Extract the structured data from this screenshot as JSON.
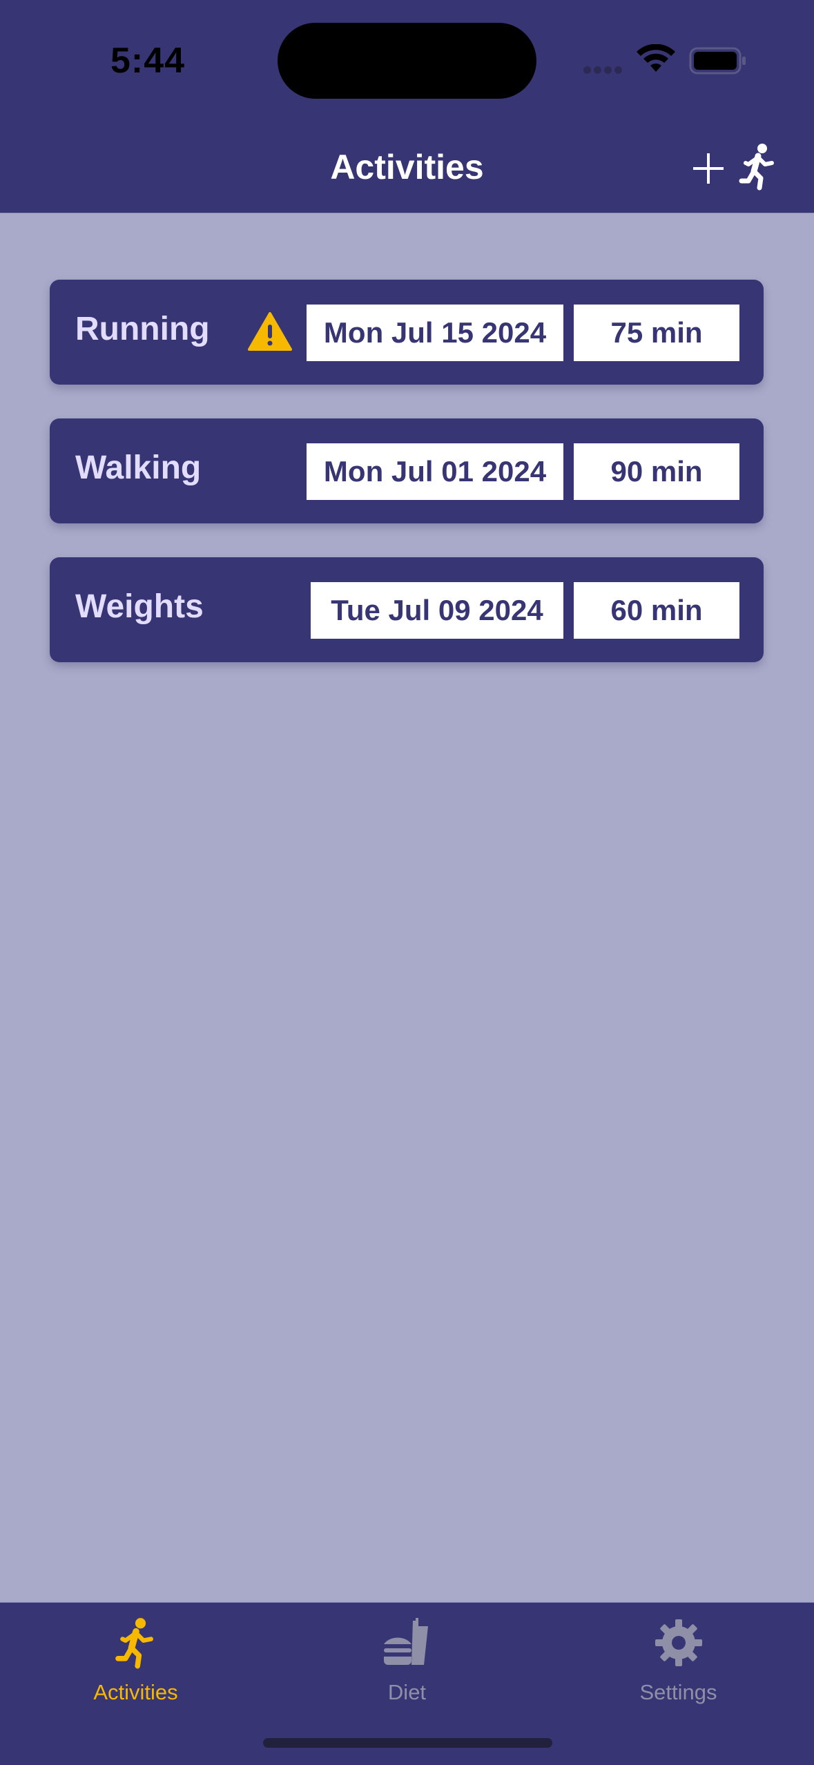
{
  "status_bar": {
    "time": "5:44",
    "icons": [
      "wifi-icon",
      "battery-icon"
    ]
  },
  "nav": {
    "title": "Activities",
    "actions": [
      {
        "icon": "plus-icon"
      },
      {
        "icon": "running-figure-icon"
      }
    ]
  },
  "activities": [
    {
      "name": "Running",
      "warning": true,
      "date": "Mon Jul 15 2024",
      "duration": "75 min"
    },
    {
      "name": "Walking",
      "warning": false,
      "date": "Mon Jul 01 2024",
      "duration": "90 min"
    },
    {
      "name": "Weights",
      "warning": false,
      "date": "Tue Jul 09 2024",
      "duration": "60 min"
    }
  ],
  "tab_bar": {
    "selected": "Activities",
    "items": [
      {
        "label": "Activities",
        "icon": "running-figure-icon"
      },
      {
        "label": "Diet",
        "icon": "burger-drink-icon"
      },
      {
        "label": "Settings",
        "icon": "gear-icon"
      }
    ]
  },
  "colors": {
    "header_bg": "#383574",
    "page_bg": "#a9a9c9",
    "card_bg": "#383574",
    "card_text": "#e2dcff",
    "accent": "#f6b900",
    "tab_inactive": "#8f8fa8",
    "warning": "#f6b900"
  }
}
